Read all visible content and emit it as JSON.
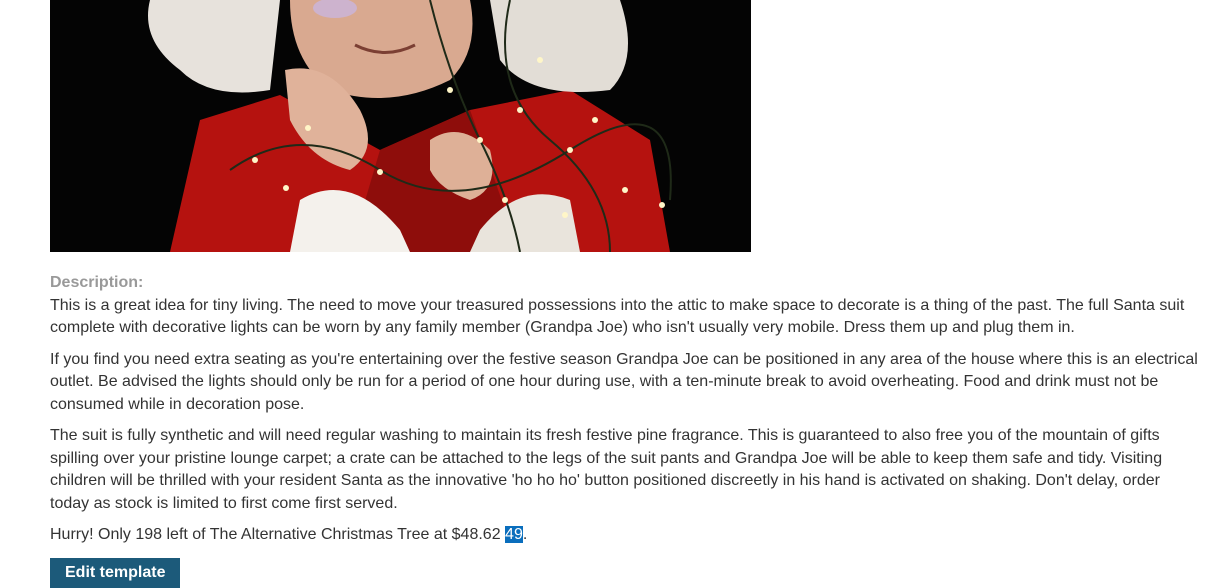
{
  "product": {
    "image_alt": "Man dressed as Santa wrapped in decorative Christmas lights"
  },
  "description": {
    "label": "Description:",
    "paragraphs": [
      "This is a great idea for tiny living. The need to move your treasured possessions into the attic to make space to decorate is a thing of the past. The full Santa suit complete with decorative lights can be worn by any family member (Grandpa Joe) who isn't usually very mobile. Dress them up and plug them in.",
      "If you find you need extra seating as you're entertaining over the festive season Grandpa Joe can be positioned in any area of the house where this is an electrical outlet. Be advised the lights should only be run for a period of one hour during use, with a ten-minute break to avoid overheating. Food and drink must not be consumed while in decoration pose.",
      "The suit is fully synthetic and will need regular washing to maintain its fresh festive pine fragrance. This is guaranteed to also free you of the mountain of gifts spilling over your pristine lounge carpet; a crate can be attached to the legs of the suit pants and Grandpa Joe will be able to keep them safe and tidy. Visiting children will be thrilled with your resident Santa as the innovative 'ho ho ho' button positioned discreetly in his hand is activated on shaking. Don't delay, order today as stock is limited to first come first served."
    ]
  },
  "stock": {
    "prefix": "Hurry! Only 198 left of The Alternative Christmas Tree at $48.62",
    "highlighted": "49",
    "suffix": "."
  },
  "actions": {
    "edit_label": "Edit template"
  },
  "colors": {
    "button_bg": "#1c5a7a",
    "selection": "#0a6ebd",
    "label": "#999999"
  }
}
